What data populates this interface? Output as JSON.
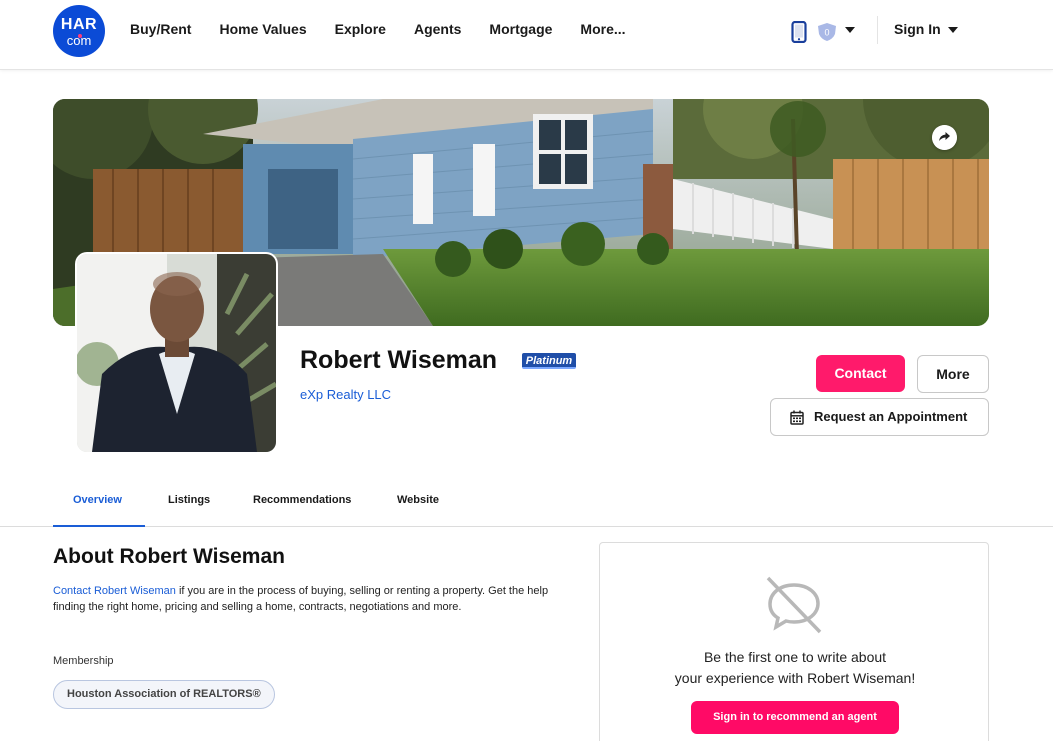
{
  "header": {
    "logo_top": "HAR",
    "logo_bottom": "com",
    "nav": [
      "Buy/Rent",
      "Home Values",
      "Explore",
      "Agents",
      "Mortgage",
      "More..."
    ],
    "notification_count": "0",
    "sign_in": "Sign In"
  },
  "profile": {
    "name": "Robert Wiseman",
    "tier": "Platinum",
    "agency": "eXp Realty LLC"
  },
  "actions": {
    "contact": "Contact",
    "more": "More",
    "appointment": "Request an Appointment"
  },
  "tabs": [
    {
      "label": "Overview",
      "active": true
    },
    {
      "label": "Listings",
      "active": false
    },
    {
      "label": "Recommendations",
      "active": false
    },
    {
      "label": "Website",
      "active": false
    }
  ],
  "about": {
    "title": "About Robert Wiseman",
    "link_text": "Contact Robert Wiseman",
    "text_line1": " if you are in the process of buying, selling or renting a property.",
    "text_rest": "Get the help finding the right home, pricing and selling a home, contracts, negotiations and more.",
    "membership_label": "Membership",
    "membership": "Houston Association of REALTORS®"
  },
  "recommendation": {
    "line1": "Be the first one to write about",
    "line2": "your experience with Robert Wiseman!",
    "button": "Sign in to recommend an agent"
  },
  "colors": {
    "brand_blue": "#0b4bd6",
    "accent_pink": "#ff1a6b",
    "link_blue": "#1a5dd6"
  },
  "icons": [
    "phone-icon",
    "shield-icon",
    "share-icon",
    "calendar-icon",
    "no-comment-icon"
  ]
}
